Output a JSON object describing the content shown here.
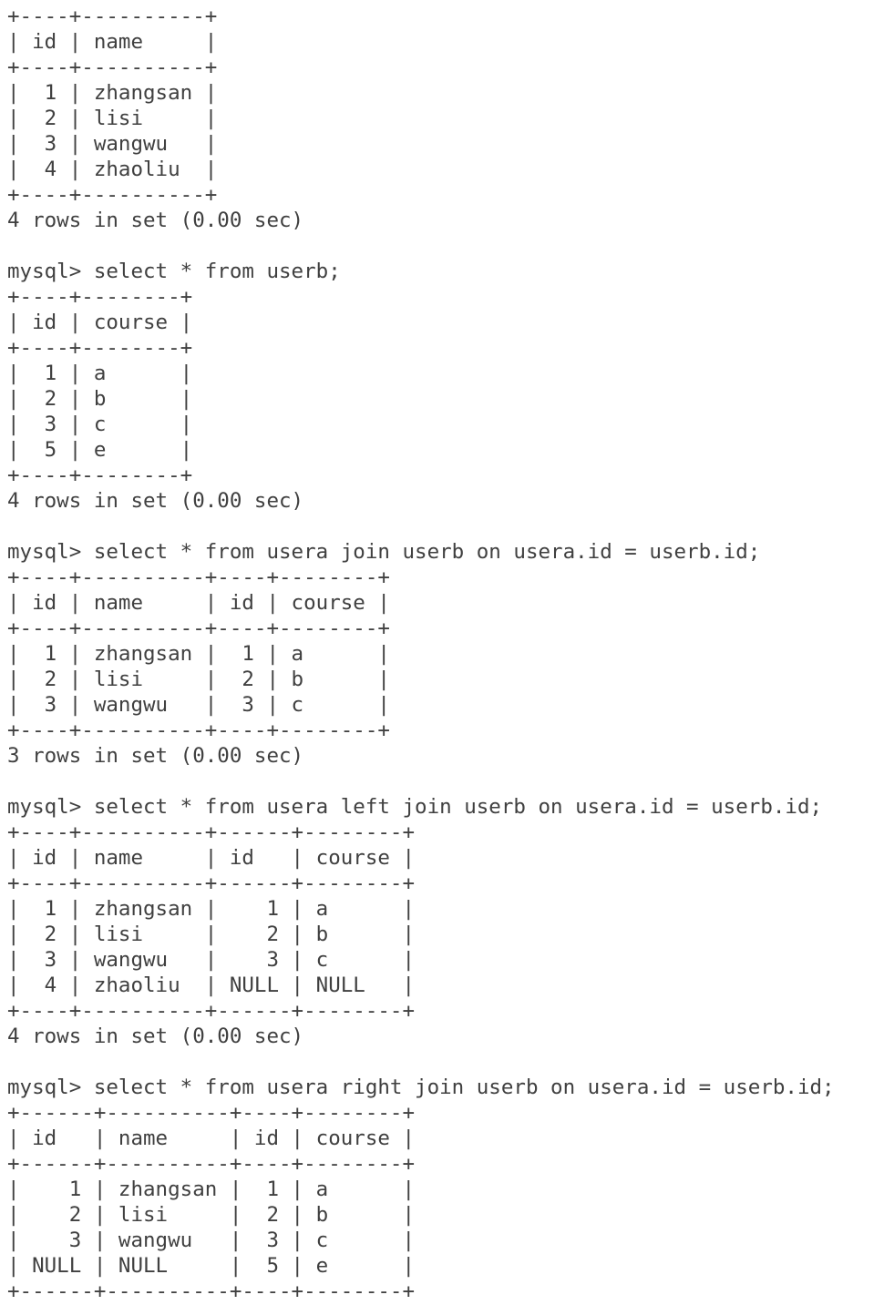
{
  "terminal": {
    "lines": [
      "+----+----------+",
      "| id | name     |",
      "+----+----------+",
      "|  1 | zhangsan |",
      "|  2 | lisi     |",
      "|  3 | wangwu   |",
      "|  4 | zhaoliu  |",
      "+----+----------+",
      "4 rows in set (0.00 sec)",
      "",
      "mysql> select * from userb;",
      "+----+--------+",
      "| id | course |",
      "+----+--------+",
      "|  1 | a      |",
      "|  2 | b      |",
      "|  3 | c      |",
      "|  5 | e      |",
      "+----+--------+",
      "4 rows in set (0.00 sec)",
      "",
      "mysql> select * from usera join userb on usera.id = userb.id;",
      "+----+----------+----+--------+",
      "| id | name     | id | course |",
      "+----+----------+----+--------+",
      "|  1 | zhangsan |  1 | a      |",
      "|  2 | lisi     |  2 | b      |",
      "|  3 | wangwu   |  3 | c      |",
      "+----+----------+----+--------+",
      "3 rows in set (0.00 sec)",
      "",
      "mysql> select * from usera left join userb on usera.id = userb.id;",
      "+----+----------+------+--------+",
      "| id | name     | id   | course |",
      "+----+----------+------+--------+",
      "|  1 | zhangsan |    1 | a      |",
      "|  2 | lisi     |    2 | b      |",
      "|  3 | wangwu   |    3 | c      |",
      "|  4 | zhaoliu  | NULL | NULL   |",
      "+----+----------+------+--------+",
      "4 rows in set (0.00 sec)",
      "",
      "mysql> select * from usera right join userb on usera.id = userb.id;",
      "+------+----------+----+--------+",
      "| id   | name     | id | course |",
      "+------+----------+----+--------+",
      "|    1 | zhangsan |  1 | a      |",
      "|    2 | lisi     |  2 | b      |",
      "|    3 | wangwu   |  3 | c      |",
      "| NULL | NULL     |  5 | e      |",
      "+------+----------+----+--------+"
    ]
  }
}
